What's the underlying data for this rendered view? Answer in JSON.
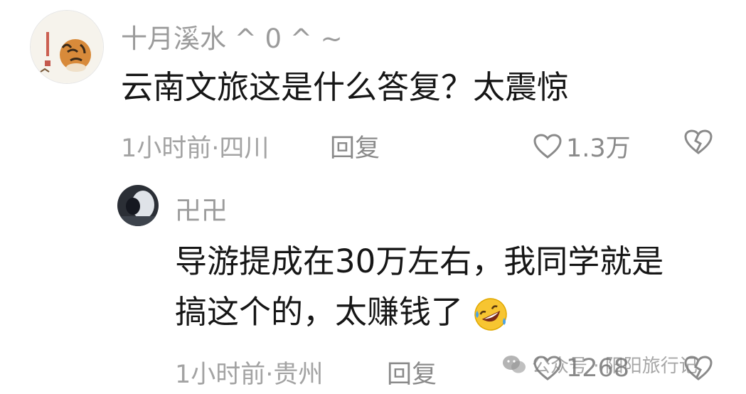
{
  "comment": {
    "avatar_icon": "tiger-painting-avatar",
    "username": "十月溪水 ^ 0 ^ ~",
    "content": "云南文旅这是什么答复？太震惊",
    "time_location": "1小时前·四川",
    "reply_label": "回复",
    "like_icon": "heart-outline-icon",
    "like_count": "1.3万",
    "dislike_icon": "broken-heart-icon"
  },
  "reply": {
    "avatar_icon": "person-photo-avatar",
    "username": "卍卍",
    "content_line1": "导游提成在30万左右，我同学就是",
    "content_line2": "搞这个的，太赚钱了",
    "emoji_icon": "rolling-on-floor-laughing-emoji",
    "time_location": "1小时前·贵州",
    "reply_label": "回复",
    "like_icon": "heart-outline-icon",
    "like_count": "1268",
    "dislike_icon": "broken-heart-icon"
  },
  "watermark": {
    "icon": "wechat-icon",
    "text": "公众号 · 阳阳旅行记"
  }
}
